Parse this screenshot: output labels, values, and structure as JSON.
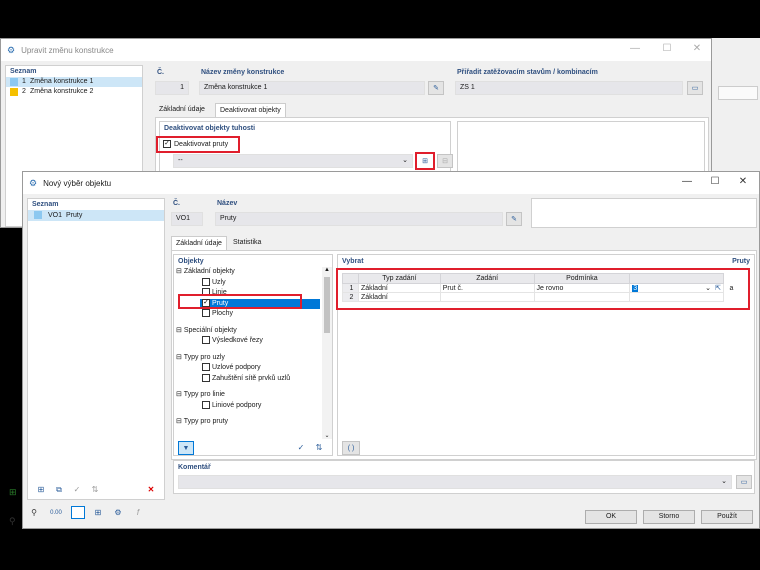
{
  "back_window": {
    "title": "Upravit změnu konstrukce",
    "list_header": "Seznam",
    "items": [
      {
        "num": "1",
        "label": "Změna konstrukce 1"
      },
      {
        "num": "2",
        "label": "Změna konstrukce 2"
      }
    ],
    "no_header": "Č.",
    "no_value": "1",
    "name_header": "Název změny konstrukce",
    "name_value": "Změna konstrukce 1",
    "assign_header": "Přiřadit zatěžovacím stavům / kombinacím",
    "assign_value": "ZS 1",
    "tabs": [
      "Základní údaje",
      "Deaktivovat objekty"
    ],
    "stiffness_header": "Deaktivovat objekty tuhosti",
    "deactivate_members_label": "Deaktivovat pruty",
    "combo_value": "--"
  },
  "front_window": {
    "title": "Nový výběr objektu",
    "list_header": "Seznam",
    "list_item": {
      "code": "VO1",
      "label": "Pruty"
    },
    "no_header": "Č.",
    "no_value": "VO1",
    "name_header": "Název",
    "name_value": "Pruty",
    "tabs": [
      "Základní údaje",
      "Statistika"
    ],
    "objects_header": "Objekty",
    "select_header": "Vybrat",
    "members_label": "Pruty",
    "tree": {
      "group1": "Základní objekty",
      "g1_items": [
        "Uzly",
        "Linie",
        "Pruty",
        "Plochy"
      ],
      "group2": "Speciální objekty",
      "g2_items": [
        "Výsledkové řezy"
      ],
      "group3": "Typy pro uzly",
      "g3_items": [
        "Uzlové podpory",
        "Zahuštění sítě prvků uzlů"
      ],
      "group4": "Typy pro linie",
      "g4_items": [
        "Liniové podpory"
      ],
      "group5": "Typy pro pruty"
    },
    "table": {
      "headers": [
        "Typ zadání",
        "Zadání",
        "Podmínka"
      ],
      "rows": [
        {
          "num": "1",
          "type": "Základní",
          "input": "Prut č.",
          "condition": "Je rovno",
          "value": "3",
          "suffix": "a"
        },
        {
          "num": "2",
          "type": "Základní",
          "input": "",
          "condition": "",
          "value": "",
          "suffix": ""
        }
      ]
    },
    "parens_button": "( )",
    "comment_header": "Komentář",
    "buttons": {
      "ok": "OK",
      "cancel": "Storno",
      "apply": "Použít"
    },
    "zoom_value": "0.00"
  },
  "colors": {
    "accent": "#0078d7",
    "highlight": "#e01e2c",
    "header": "#2f4f7f"
  }
}
